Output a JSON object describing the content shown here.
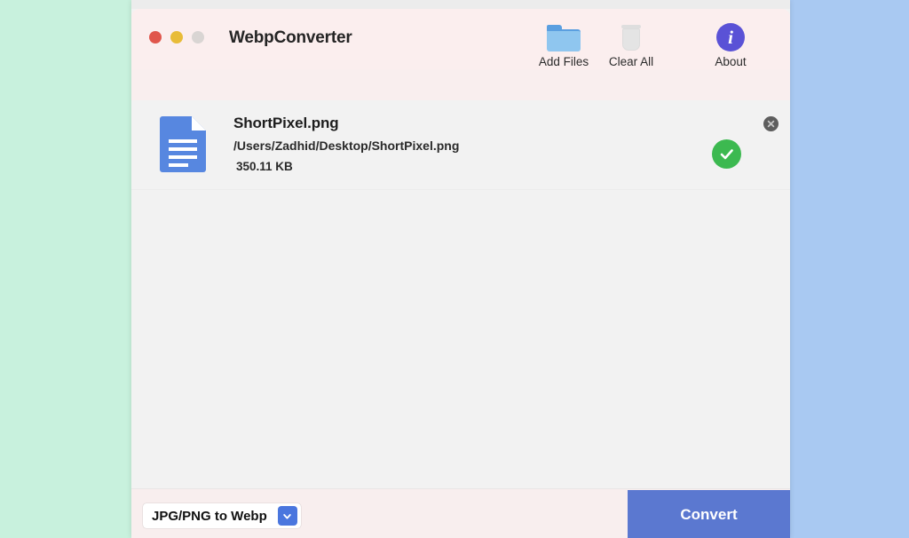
{
  "window": {
    "title": "WebpConverter",
    "traffic_lights": [
      {
        "name": "close",
        "color": "#e0564c"
      },
      {
        "name": "minimize",
        "color": "#e8bc38"
      },
      {
        "name": "zoom",
        "color": "#d9d5d3"
      }
    ]
  },
  "toolbar": {
    "add_files_label": "Add Files",
    "clear_all_label": "Clear All",
    "about_label": "About",
    "about_glyph": "i"
  },
  "files": [
    {
      "name": "ShortPixel.png",
      "path": "/Users/Zadhid/Desktop/ShortPixel.png",
      "size": "350.11 KB",
      "status": "converted"
    }
  ],
  "bottom": {
    "format_value": "JPG/PNG to Webp",
    "convert_label": "Convert"
  },
  "colors": {
    "accent_blue": "#5b78d0",
    "chevron_blue": "#4a76de",
    "success_green": "#3cb950",
    "about_purple": "#5a52d6",
    "titlebar_pink": "#fbeeee",
    "desktop_left": "#c8f1dd",
    "desktop_right": "#a9c9f2"
  }
}
